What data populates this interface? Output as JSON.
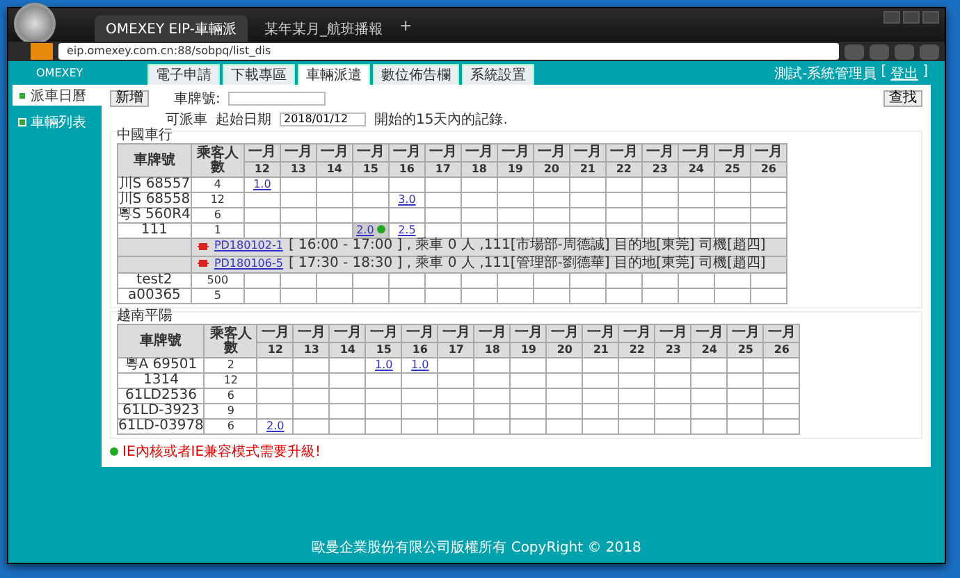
{
  "browser": {
    "tabs": [
      {
        "label": "OMEXEY EIP-車輛派",
        "selected": true
      },
      {
        "label": "某年某月_航班播報",
        "selected": false
      }
    ],
    "new_tab": "+",
    "address": "eip.omexey.com.cn:88/sobpq/list_dis"
  },
  "header": {
    "brand": "OMEXEY",
    "user": "測試-系統管理員",
    "logout": "登出",
    "bracket_open": "[",
    "bracket_close": "]"
  },
  "nav": [
    {
      "label": "電子申請",
      "selected": false
    },
    {
      "label": "下載專區",
      "selected": false
    },
    {
      "label": "車輛派遣",
      "selected": true
    },
    {
      "label": "數位佈告欄",
      "selected": false
    },
    {
      "label": "系統設置",
      "selected": false
    }
  ],
  "sidebar": [
    {
      "label": "派車日曆",
      "selected": true
    },
    {
      "label": "車輛列表",
      "selected": false
    }
  ],
  "toolbar": {
    "add_button": "新增",
    "plate_label": "車牌號:",
    "search_button": "查找",
    "available_label": "可派車",
    "date_label": "起始日期",
    "date_value": "2018/01/12",
    "range_note": "開始的15天內的記錄."
  },
  "sections": [
    {
      "title": "中國車行",
      "columns": [
        "車牌號",
        "乘客人數"
      ],
      "months": [
        "一月",
        "一月",
        "一月",
        "一月",
        "一月",
        "一月",
        "一月",
        "一月",
        "一月",
        "一月",
        "一月",
        "一月",
        "一月",
        "一月",
        "一月"
      ],
      "days": [
        "12",
        "13",
        "14",
        "15",
        "16",
        "17",
        "18",
        "19",
        "20",
        "21",
        "22",
        "23",
        "24",
        "25",
        "26"
      ],
      "rows": [
        {
          "kind": "vehicle",
          "plate": "川S 68557",
          "passengers": "4",
          "cells": [
            {
              "text": "1.0",
              "highlighted": false
            },
            null,
            null,
            null,
            null,
            null,
            null,
            null,
            null,
            null,
            null,
            null,
            null,
            null,
            null
          ]
        },
        {
          "kind": "vehicle",
          "plate": "川S 68558",
          "passengers": "12",
          "cells": [
            null,
            null,
            null,
            null,
            {
              "text": "3.0",
              "highlighted": false
            },
            null,
            null,
            null,
            null,
            null,
            null,
            null,
            null,
            null,
            null
          ]
        },
        {
          "kind": "vehicle",
          "plate": "粵S 560R4",
          "passengers": "6",
          "cells": [
            null,
            null,
            null,
            null,
            null,
            null,
            null,
            null,
            null,
            null,
            null,
            null,
            null,
            null,
            null
          ]
        },
        {
          "kind": "vehicle",
          "plate": "111",
          "passengers": "1",
          "cells": [
            null,
            null,
            null,
            {
              "text": "2.0",
              "highlighted": true
            },
            {
              "text": "2.5",
              "highlighted": false
            },
            null,
            null,
            null,
            null,
            null,
            null,
            null,
            null,
            null,
            null
          ]
        },
        {
          "kind": "detail",
          "order": "PD180102-1",
          "info": "[ 16:00 - 17:00 ] , 乘車 0 人 ,111[市場部-周德誠] 目的地[東莞] 司機[趙四]"
        },
        {
          "kind": "detail",
          "order": "PD180106-5",
          "info": "[ 17:30 - 18:30 ] , 乘車 0 人 ,111[管理部-劉德華] 目的地[東莞] 司機[趙四]"
        },
        {
          "kind": "vehicle",
          "plate": "test2",
          "passengers": "500",
          "cells": [
            null,
            null,
            null,
            null,
            null,
            null,
            null,
            null,
            null,
            null,
            null,
            null,
            null,
            null,
            null
          ]
        },
        {
          "kind": "vehicle",
          "plate": "a00365",
          "passengers": "5",
          "cells": [
            null,
            null,
            null,
            null,
            null,
            null,
            null,
            null,
            null,
            null,
            null,
            null,
            null,
            null,
            null
          ]
        }
      ]
    },
    {
      "title": "越南平陽",
      "columns": [
        "車牌號",
        "乘客人數"
      ],
      "months": [
        "一月",
        "一月",
        "一月",
        "一月",
        "一月",
        "一月",
        "一月",
        "一月",
        "一月",
        "一月",
        "一月",
        "一月",
        "一月",
        "一月",
        "一月"
      ],
      "days": [
        "12",
        "13",
        "14",
        "15",
        "16",
        "17",
        "18",
        "19",
        "20",
        "21",
        "22",
        "23",
        "24",
        "25",
        "26"
      ],
      "rows": [
        {
          "kind": "vehicle",
          "plate": "粵A 69501",
          "passengers": "2",
          "cells": [
            null,
            null,
            null,
            {
              "text": "1.0",
              "highlighted": false
            },
            {
              "text": "1.0",
              "highlighted": false
            },
            null,
            null,
            null,
            null,
            null,
            null,
            null,
            null,
            null,
            null
          ]
        },
        {
          "kind": "vehicle",
          "plate": "1314",
          "passengers": "12",
          "cells": [
            null,
            null,
            null,
            null,
            null,
            null,
            null,
            null,
            null,
            null,
            null,
            null,
            null,
            null,
            null
          ]
        },
        {
          "kind": "vehicle",
          "plate": "61LD2536",
          "passengers": "6",
          "cells": [
            null,
            null,
            null,
            null,
            null,
            null,
            null,
            null,
            null,
            null,
            null,
            null,
            null,
            null,
            null
          ]
        },
        {
          "kind": "vehicle",
          "plate": "61LD-3923",
          "passengers": "9",
          "cells": [
            null,
            null,
            null,
            null,
            null,
            null,
            null,
            null,
            null,
            null,
            null,
            null,
            null,
            null,
            null
          ]
        },
        {
          "kind": "vehicle",
          "plate": "61LD-03978",
          "passengers": "6",
          "cells": [
            {
              "text": "2.0",
              "highlighted": false
            },
            null,
            null,
            null,
            null,
            null,
            null,
            null,
            null,
            null,
            null,
            null,
            null,
            null,
            null
          ]
        }
      ]
    }
  ],
  "note": "IE內核或者IE兼容模式需要升級!",
  "footer": "歐曼企業股份有限公司版權所有 CopyRight © 2018"
}
